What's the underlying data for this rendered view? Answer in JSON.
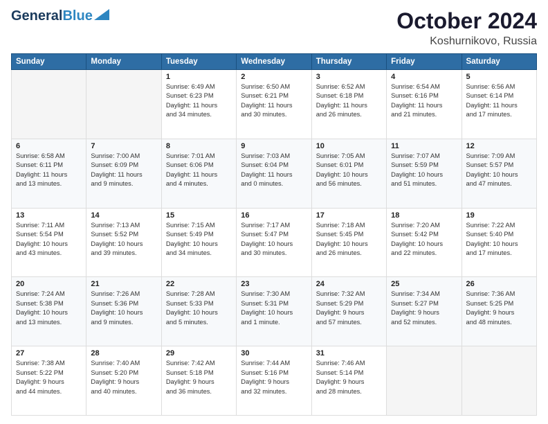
{
  "logo": {
    "general": "General",
    "blue": "Blue"
  },
  "title": "October 2024",
  "location": "Koshurnikovo, Russia",
  "headers": [
    "Sunday",
    "Monday",
    "Tuesday",
    "Wednesday",
    "Thursday",
    "Friday",
    "Saturday"
  ],
  "weeks": [
    [
      {
        "day": "",
        "details": ""
      },
      {
        "day": "",
        "details": ""
      },
      {
        "day": "1",
        "details": "Sunrise: 6:49 AM\nSunset: 6:23 PM\nDaylight: 11 hours\nand 34 minutes."
      },
      {
        "day": "2",
        "details": "Sunrise: 6:50 AM\nSunset: 6:21 PM\nDaylight: 11 hours\nand 30 minutes."
      },
      {
        "day": "3",
        "details": "Sunrise: 6:52 AM\nSunset: 6:18 PM\nDaylight: 11 hours\nand 26 minutes."
      },
      {
        "day": "4",
        "details": "Sunrise: 6:54 AM\nSunset: 6:16 PM\nDaylight: 11 hours\nand 21 minutes."
      },
      {
        "day": "5",
        "details": "Sunrise: 6:56 AM\nSunset: 6:14 PM\nDaylight: 11 hours\nand 17 minutes."
      }
    ],
    [
      {
        "day": "6",
        "details": "Sunrise: 6:58 AM\nSunset: 6:11 PM\nDaylight: 11 hours\nand 13 minutes."
      },
      {
        "day": "7",
        "details": "Sunrise: 7:00 AM\nSunset: 6:09 PM\nDaylight: 11 hours\nand 9 minutes."
      },
      {
        "day": "8",
        "details": "Sunrise: 7:01 AM\nSunset: 6:06 PM\nDaylight: 11 hours\nand 4 minutes."
      },
      {
        "day": "9",
        "details": "Sunrise: 7:03 AM\nSunset: 6:04 PM\nDaylight: 11 hours\nand 0 minutes."
      },
      {
        "day": "10",
        "details": "Sunrise: 7:05 AM\nSunset: 6:01 PM\nDaylight: 10 hours\nand 56 minutes."
      },
      {
        "day": "11",
        "details": "Sunrise: 7:07 AM\nSunset: 5:59 PM\nDaylight: 10 hours\nand 51 minutes."
      },
      {
        "day": "12",
        "details": "Sunrise: 7:09 AM\nSunset: 5:57 PM\nDaylight: 10 hours\nand 47 minutes."
      }
    ],
    [
      {
        "day": "13",
        "details": "Sunrise: 7:11 AM\nSunset: 5:54 PM\nDaylight: 10 hours\nand 43 minutes."
      },
      {
        "day": "14",
        "details": "Sunrise: 7:13 AM\nSunset: 5:52 PM\nDaylight: 10 hours\nand 39 minutes."
      },
      {
        "day": "15",
        "details": "Sunrise: 7:15 AM\nSunset: 5:49 PM\nDaylight: 10 hours\nand 34 minutes."
      },
      {
        "day": "16",
        "details": "Sunrise: 7:17 AM\nSunset: 5:47 PM\nDaylight: 10 hours\nand 30 minutes."
      },
      {
        "day": "17",
        "details": "Sunrise: 7:18 AM\nSunset: 5:45 PM\nDaylight: 10 hours\nand 26 minutes."
      },
      {
        "day": "18",
        "details": "Sunrise: 7:20 AM\nSunset: 5:42 PM\nDaylight: 10 hours\nand 22 minutes."
      },
      {
        "day": "19",
        "details": "Sunrise: 7:22 AM\nSunset: 5:40 PM\nDaylight: 10 hours\nand 17 minutes."
      }
    ],
    [
      {
        "day": "20",
        "details": "Sunrise: 7:24 AM\nSunset: 5:38 PM\nDaylight: 10 hours\nand 13 minutes."
      },
      {
        "day": "21",
        "details": "Sunrise: 7:26 AM\nSunset: 5:36 PM\nDaylight: 10 hours\nand 9 minutes."
      },
      {
        "day": "22",
        "details": "Sunrise: 7:28 AM\nSunset: 5:33 PM\nDaylight: 10 hours\nand 5 minutes."
      },
      {
        "day": "23",
        "details": "Sunrise: 7:30 AM\nSunset: 5:31 PM\nDaylight: 10 hours\nand 1 minute."
      },
      {
        "day": "24",
        "details": "Sunrise: 7:32 AM\nSunset: 5:29 PM\nDaylight: 9 hours\nand 57 minutes."
      },
      {
        "day": "25",
        "details": "Sunrise: 7:34 AM\nSunset: 5:27 PM\nDaylight: 9 hours\nand 52 minutes."
      },
      {
        "day": "26",
        "details": "Sunrise: 7:36 AM\nSunset: 5:25 PM\nDaylight: 9 hours\nand 48 minutes."
      }
    ],
    [
      {
        "day": "27",
        "details": "Sunrise: 7:38 AM\nSunset: 5:22 PM\nDaylight: 9 hours\nand 44 minutes."
      },
      {
        "day": "28",
        "details": "Sunrise: 7:40 AM\nSunset: 5:20 PM\nDaylight: 9 hours\nand 40 minutes."
      },
      {
        "day": "29",
        "details": "Sunrise: 7:42 AM\nSunset: 5:18 PM\nDaylight: 9 hours\nand 36 minutes."
      },
      {
        "day": "30",
        "details": "Sunrise: 7:44 AM\nSunset: 5:16 PM\nDaylight: 9 hours\nand 32 minutes."
      },
      {
        "day": "31",
        "details": "Sunrise: 7:46 AM\nSunset: 5:14 PM\nDaylight: 9 hours\nand 28 minutes."
      },
      {
        "day": "",
        "details": ""
      },
      {
        "day": "",
        "details": ""
      }
    ]
  ]
}
